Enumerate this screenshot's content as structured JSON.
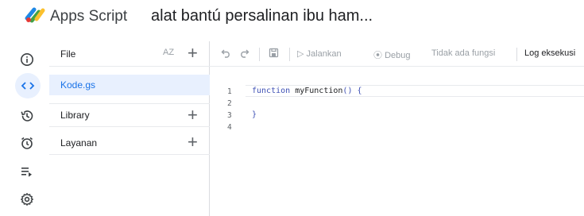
{
  "header": {
    "app_name": "Apps Script",
    "project_title": "alat bantú persalinan ibu ham..."
  },
  "rail": {
    "items": [
      {
        "icon": "info-icon"
      },
      {
        "icon": "code-icon",
        "active": true
      },
      {
        "icon": "history-icon"
      },
      {
        "icon": "alarm-icon"
      },
      {
        "icon": "executions-icon"
      },
      {
        "icon": "settings-icon"
      }
    ]
  },
  "files_panel": {
    "file_header_label": "File",
    "sort_label": "AZ",
    "files": [
      "Kode.gs"
    ],
    "library_label": "Library",
    "services_label": "Layanan"
  },
  "toolbar": {
    "run_label": "Jalankan",
    "debug_label": "Debug",
    "function_select": "Tidak ada fungsi",
    "log_label": "Log eksekusi"
  },
  "editor": {
    "line_numbers": [
      "1",
      "2",
      "3",
      "4"
    ],
    "line1_keyword": "function",
    "line1_name": "myFunction",
    "line1_rest": "() {",
    "line3": "}"
  },
  "colors": {
    "accent": "#1a73e8",
    "active_bg": "#e8f0fe"
  }
}
